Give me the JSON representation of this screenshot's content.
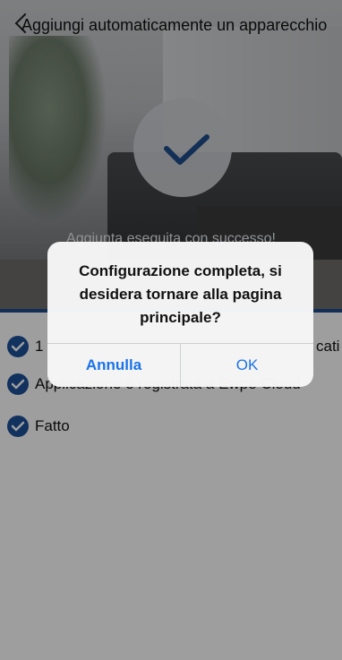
{
  "header": {
    "title": "Aggiungi automaticamente un apparecchio",
    "back_icon": "back-arrow-icon"
  },
  "hero": {
    "status_icon": "checkmark-icon",
    "success_text": "Aggiunta eseguita con successo!"
  },
  "steps": [
    {
      "label": "1",
      "icon": "check-circle-icon",
      "hidden_tail": "cati"
    },
    {
      "label": "Applicazione è registrata a Ewpe Cloud",
      "icon": "check-circle-icon"
    },
    {
      "label": "Fatto",
      "icon": "check-circle-icon"
    }
  ],
  "dialog": {
    "message": "Configurazione completa, si desidera tornare alla pagina principale?",
    "cancel_label": "Annulla",
    "ok_label": "OK"
  },
  "colors": {
    "accent": "#1a73e8",
    "step_check": "#1c4f98",
    "divider": "#1f4d8a"
  }
}
